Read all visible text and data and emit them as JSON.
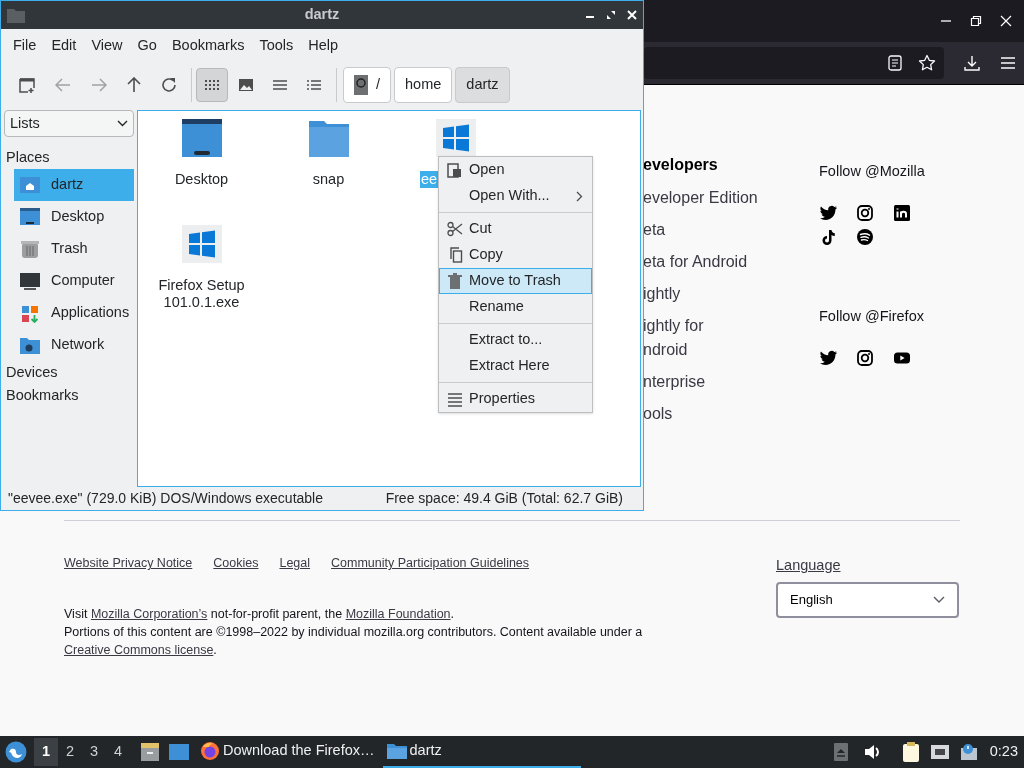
{
  "browser": {
    "developers": {
      "heading": "evelopers",
      "links": [
        {
          "lines": [
            "eveloper Edition"
          ]
        },
        {
          "lines": [
            "eta"
          ]
        },
        {
          "lines": [
            "eta for Android"
          ]
        },
        {
          "lines": [
            "ightly"
          ]
        },
        {
          "lines": [
            "ightly for",
            "ndroid"
          ]
        },
        {
          "lines": [
            "nterprise"
          ]
        },
        {
          "lines": [
            "ools"
          ]
        }
      ]
    },
    "follow": [
      {
        "title": "Follow @Mozilla",
        "kind": "mozilla"
      },
      {
        "title": "Follow @Firefox",
        "kind": "firefox"
      }
    ],
    "footer_links": [
      "Website Privacy Notice",
      "Cookies",
      "Legal",
      "Community Participation Guidelines"
    ],
    "notice": [
      {
        "kind": "text",
        "text": "Visit "
      },
      {
        "kind": "link",
        "text": "Mozilla Corporation’s"
      },
      {
        "kind": "text",
        "text": " not-for-profit parent, the "
      },
      {
        "kind": "link",
        "text": "Mozilla Foundation"
      },
      {
        "kind": "text",
        "text": "."
      },
      {
        "kind": "break"
      },
      {
        "kind": "text",
        "text": "Portions of this content are ©1998–2022 by individual mozilla.org contributors. Content available under a "
      },
      {
        "kind": "link",
        "text": "Creative Commons license"
      },
      {
        "kind": "text",
        "text": "."
      }
    ],
    "language": {
      "label": "Language",
      "value": "English"
    }
  },
  "file_manager": {
    "title": "dartz",
    "menu": [
      "File",
      "Edit",
      "View",
      "Go",
      "Bookmarks",
      "Tools",
      "Help"
    ],
    "view_modes": [
      {
        "kind": "icons",
        "selected": true
      },
      {
        "kind": "thumbnails",
        "selected": false
      },
      {
        "kind": "compact",
        "selected": false
      },
      {
        "kind": "detailed",
        "selected": false
      }
    ],
    "path": [
      {
        "label": "/",
        "selected": false
      },
      {
        "label": "home",
        "selected": false
      },
      {
        "label": "dartz",
        "selected": true
      }
    ],
    "sidebar": {
      "dropdown": "Lists",
      "sections": [
        {
          "title": "Places",
          "items": [
            {
              "label": "dartz",
              "kind": "home",
              "selected": true
            },
            {
              "label": "Desktop",
              "kind": "desktop",
              "selected": false
            },
            {
              "label": "Trash",
              "kind": "trash",
              "selected": false
            },
            {
              "label": "Computer",
              "kind": "computer",
              "selected": false
            },
            {
              "label": "Applications",
              "kind": "applications",
              "selected": false
            },
            {
              "label": "Network",
              "kind": "network",
              "selected": false
            }
          ]
        },
        {
          "title": "Devices"
        },
        {
          "title": "Bookmarks"
        }
      ]
    },
    "files": [
      {
        "label": "Desktop",
        "kind": "desktop",
        "selected": false
      },
      {
        "label": "snap",
        "kind": "folder",
        "selected": false
      },
      {
        "label": "ee",
        "kind": "exe",
        "selected": true
      },
      {
        "label": "Firefox Setup 101.0.1.exe",
        "kind": "exe",
        "selected": false
      }
    ],
    "context_menu": [
      [
        {
          "label": "Open",
          "kind": "open",
          "selected": false
        },
        {
          "label": "Open With...",
          "kind": "submenu",
          "selected": false
        }
      ],
      [
        {
          "label": "Cut",
          "kind": "cut",
          "selected": false
        },
        {
          "label": "Copy",
          "kind": "copy",
          "selected": false
        },
        {
          "label": "Move to Trash",
          "kind": "trash",
          "selected": true
        },
        {
          "label": "Rename",
          "kind": "none",
          "selected": false
        }
      ],
      [
        {
          "label": "Extract to...",
          "kind": "none",
          "selected": false
        },
        {
          "label": "Extract Here",
          "kind": "none",
          "selected": false
        }
      ],
      [
        {
          "label": "Properties",
          "kind": "properties",
          "selected": false
        }
      ]
    ],
    "status_left": "\"eevee.exe\" (729.0 KiB) DOS/Windows executable",
    "status_right": "Free space: 49.4 GiB (Total: 62.7 GiB)"
  },
  "taskbar": {
    "workspaces": [
      {
        "label": "1",
        "selected": true
      },
      {
        "label": "2",
        "selected": false
      },
      {
        "label": "3",
        "selected": false
      },
      {
        "label": "4",
        "selected": false
      }
    ],
    "tasks": [
      {
        "label": "Download the Firefox…",
        "kind": "firefox",
        "selected": false
      },
      {
        "label": "dartz",
        "kind": "folder",
        "selected": true
      }
    ],
    "clock": "0:23"
  }
}
